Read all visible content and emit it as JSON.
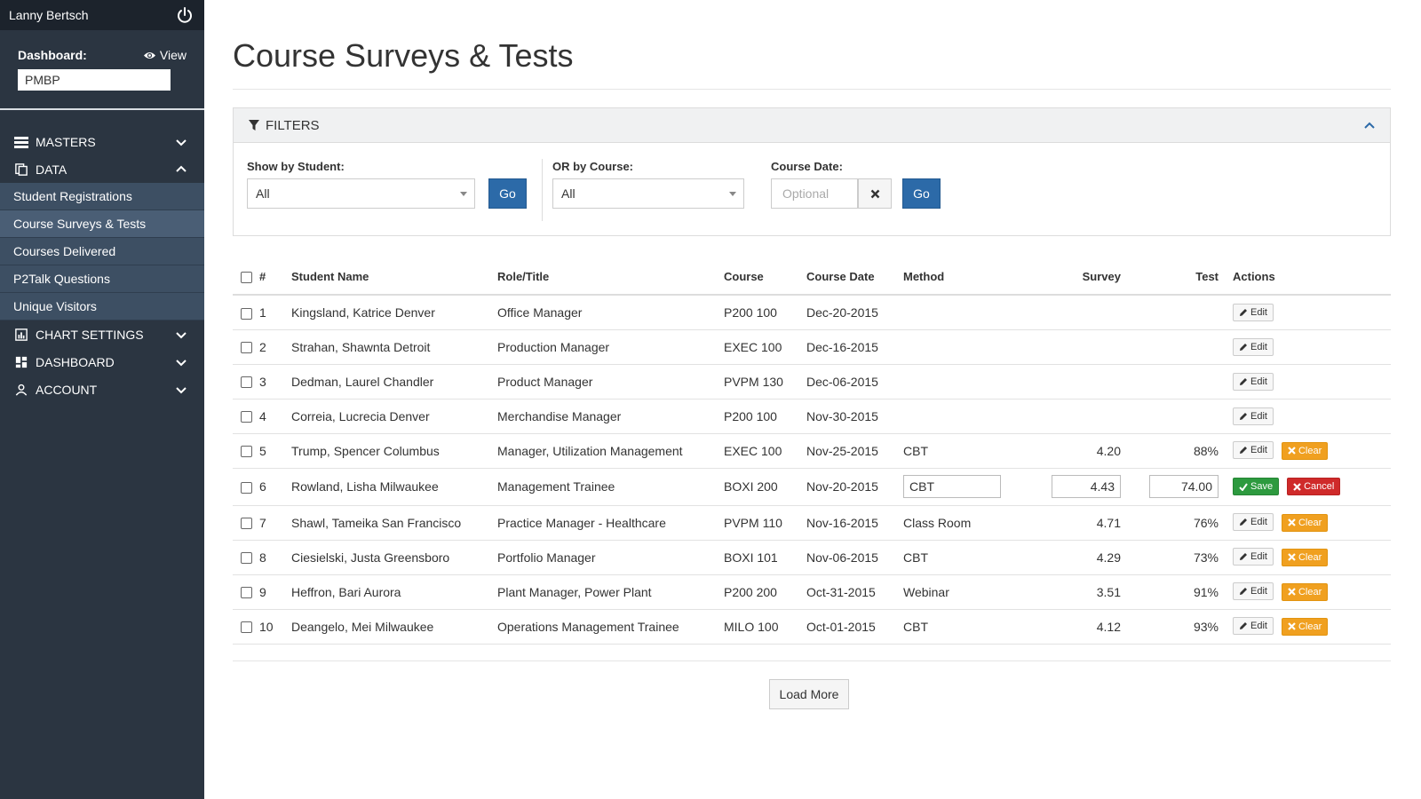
{
  "user": {
    "name": "Lanny Bertsch"
  },
  "dashboard": {
    "label": "Dashboard:",
    "view_label": "View",
    "value": "PMBP"
  },
  "nav": {
    "masters": "MASTERS",
    "data": "DATA",
    "data_items": [
      "Student Registrations",
      "Course Surveys & Tests",
      "Courses Delivered",
      "P2Talk Questions",
      "Unique Visitors"
    ],
    "chart_settings": "CHART SETTINGS",
    "dashboard": "DASHBOARD",
    "account": "ACCOUNT"
  },
  "page": {
    "title": "Course Surveys & Tests"
  },
  "filters": {
    "title": "FILTERS",
    "student_label": "Show by Student:",
    "student_value": "All",
    "course_label": "OR by Course:",
    "course_value": "All",
    "date_label": "Course Date:",
    "date_placeholder": "Optional",
    "go_label": "Go"
  },
  "table": {
    "headers": {
      "num": "#",
      "student": "Student Name",
      "role": "Role/Title",
      "course": "Course",
      "date": "Course Date",
      "method": "Method",
      "survey": "Survey",
      "test": "Test",
      "actions": "Actions"
    },
    "edit_label": "Edit",
    "clear_label": "Clear",
    "save_label": "Save",
    "cancel_label": "Cancel",
    "rows": [
      {
        "num": "1",
        "student": "Kingsland, Katrice Denver",
        "role": "Office Manager",
        "course": "P200 100",
        "date": "Dec-20-2015",
        "method": "",
        "survey": "",
        "test": ""
      },
      {
        "num": "2",
        "student": "Strahan, Shawnta Detroit",
        "role": "Production Manager",
        "course": "EXEC 100",
        "date": "Dec-16-2015",
        "method": "",
        "survey": "",
        "test": ""
      },
      {
        "num": "3",
        "student": "Dedman, Laurel Chandler",
        "role": "Product Manager",
        "course": "PVPM 130",
        "date": "Dec-06-2015",
        "method": "",
        "survey": "",
        "test": ""
      },
      {
        "num": "4",
        "student": "Correia, Lucrecia Denver",
        "role": "Merchandise Manager",
        "course": "P200 100",
        "date": "Nov-30-2015",
        "method": "",
        "survey": "",
        "test": ""
      },
      {
        "num": "5",
        "student": "Trump, Spencer Columbus",
        "role": "Manager, Utilization Management",
        "course": "EXEC 100",
        "date": "Nov-25-2015",
        "method": "CBT",
        "survey": "4.20",
        "test": "88%"
      },
      {
        "num": "6",
        "student": "Rowland, Lisha Milwaukee",
        "role": "Management Trainee",
        "course": "BOXI 200",
        "date": "Nov-20-2015",
        "method": "CBT",
        "survey": "4.43",
        "test": "74.00"
      },
      {
        "num": "7",
        "student": "Shawl, Tameika San Francisco",
        "role": "Practice Manager - Healthcare",
        "course": "PVPM 110",
        "date": "Nov-16-2015",
        "method": "Class Room",
        "survey": "4.71",
        "test": "76%"
      },
      {
        "num": "8",
        "student": "Ciesielski, Justa Greensboro",
        "role": "Portfolio Manager",
        "course": "BOXI 101",
        "date": "Nov-06-2015",
        "method": "CBT",
        "survey": "4.29",
        "test": "73%"
      },
      {
        "num": "9",
        "student": "Heffron, Bari Aurora",
        "role": "Plant Manager, Power Plant",
        "course": "P200 200",
        "date": "Oct-31-2015",
        "method": "Webinar",
        "survey": "3.51",
        "test": "91%"
      },
      {
        "num": "10",
        "student": "Deangelo, Mei Milwaukee",
        "role": "Operations Management Trainee",
        "course": "MILO 100",
        "date": "Oct-01-2015",
        "method": "CBT",
        "survey": "4.12",
        "test": "93%"
      }
    ]
  },
  "load_more_label": "Load More"
}
